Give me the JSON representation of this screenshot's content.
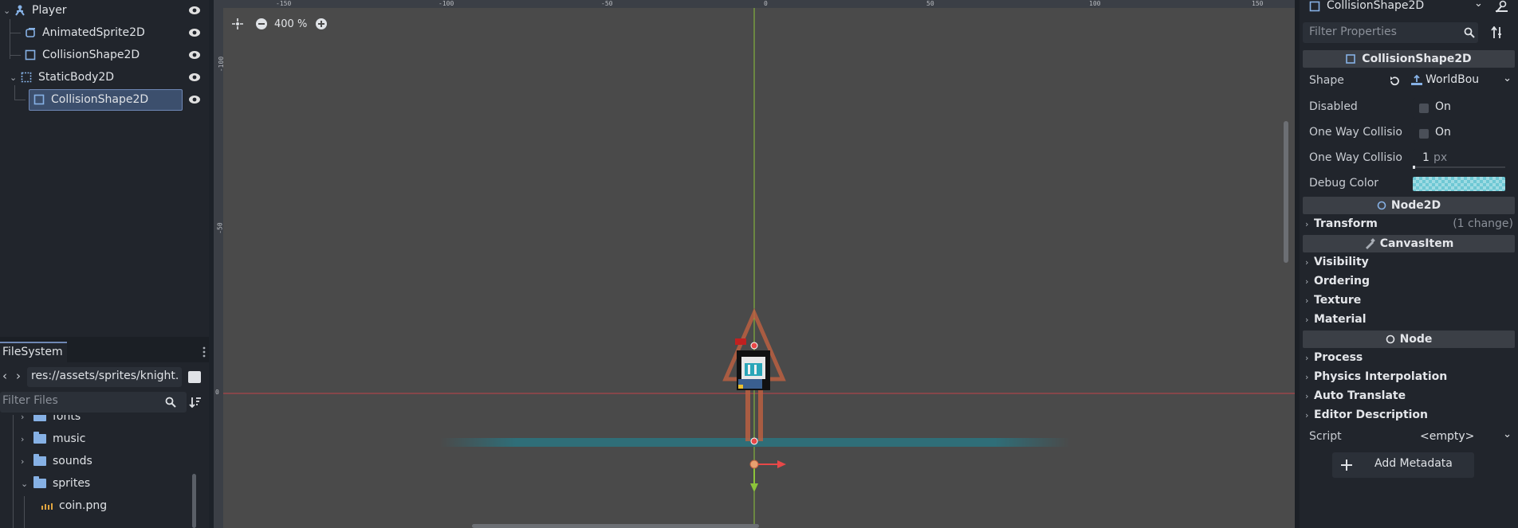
{
  "scene_tree": {
    "items": [
      {
        "label": "Player",
        "icon": "character-body-icon"
      },
      {
        "label": "AnimatedSprite2D",
        "icon": "animated-sprite-icon"
      },
      {
        "label": "CollisionShape2D",
        "icon": "collision-shape-icon"
      },
      {
        "label": "StaticBody2D",
        "icon": "static-body-icon"
      },
      {
        "label": "CollisionShape2D",
        "icon": "collision-shape-icon"
      }
    ]
  },
  "filesystem": {
    "tab_label": "FileSystem",
    "path": "res://assets/sprites/knight.",
    "filter_placeholder": "Filter Files",
    "items": [
      {
        "label": "fonts",
        "type": "folder"
      },
      {
        "label": "music",
        "type": "folder"
      },
      {
        "label": "sounds",
        "type": "folder"
      },
      {
        "label": "sprites",
        "type": "folder"
      },
      {
        "label": "coin.png",
        "type": "file"
      }
    ]
  },
  "viewport": {
    "zoom": "400 %",
    "ruler_top": [
      "-150",
      "-100",
      "-50",
      "0",
      "50",
      "100",
      "150"
    ],
    "ruler_left": [
      "-100",
      "-50",
      "0"
    ],
    "colors": {
      "background": "#4a4a4a",
      "x_axis": "#c0434a",
      "y_axis": "#8cc43a",
      "platform": "#2f6e78"
    }
  },
  "inspector": {
    "node_name": "CollisionShape2D",
    "filter_placeholder": "Filter Properties",
    "class_header": "CollisionShape2D",
    "properties": [
      {
        "name": "Shape",
        "value": "WorldBou"
      },
      {
        "name": "Disabled",
        "value": "On"
      },
      {
        "name": "One Way Collisio",
        "value": "On"
      },
      {
        "name": "One Way Collisio",
        "value": "1",
        "unit": "px"
      },
      {
        "name": "Debug Color",
        "value": ""
      }
    ],
    "node2d_header": "Node2D",
    "transform": {
      "label": "Transform",
      "note": "(1 change)"
    },
    "canvasitem_header": "CanvasItem",
    "canvasitem_cats": [
      "Visibility",
      "Ordering",
      "Texture",
      "Material"
    ],
    "node_header": "Node",
    "node_cats": [
      "Process",
      "Physics Interpolation",
      "Auto Translate",
      "Editor Description"
    ],
    "script": {
      "name": "Script",
      "value": "<empty>"
    },
    "add_metadata": "Add Metadata"
  }
}
